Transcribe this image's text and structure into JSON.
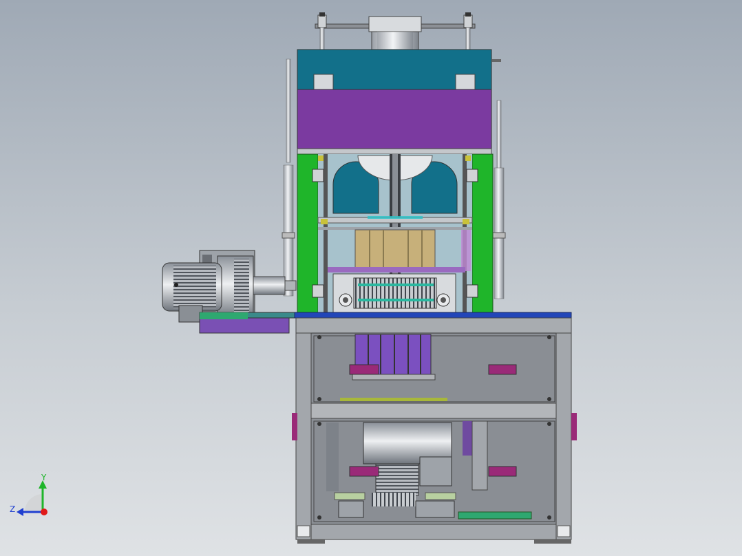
{
  "axes": {
    "y_label": "Y",
    "z_label": "Z"
  },
  "colors": {
    "purple": "#7b3aa0",
    "green": "#1fb52a",
    "teal": "#12708a",
    "frame": "#8c9096",
    "magenta": "#9a2a78",
    "x_axis": "#e01818",
    "y_axis": "#1fb52a",
    "z_axis": "#1f3fd0"
  }
}
